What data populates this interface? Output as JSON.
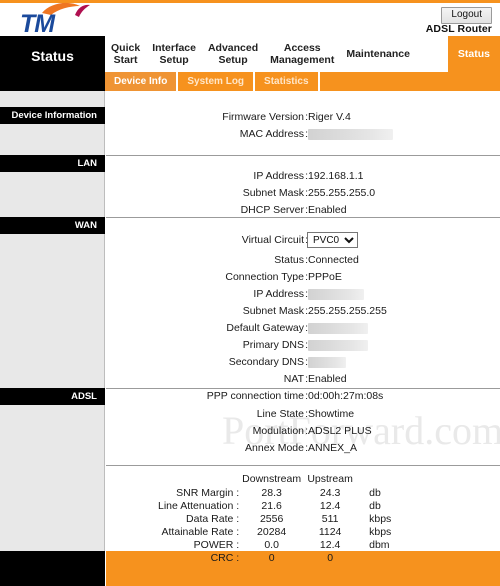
{
  "header": {
    "logo_text": "TM",
    "logout_label": "Logout",
    "router_name": "ADSL Router"
  },
  "nav": {
    "status_box_label": "Status",
    "items": [
      {
        "label": "Quick\nStart",
        "active": false
      },
      {
        "label": "Interface\nSetup",
        "active": false
      },
      {
        "label": "Advanced\nSetup",
        "active": false
      },
      {
        "label": "Access\nManagement",
        "active": false
      },
      {
        "label": "Maintenance",
        "active": false
      },
      {
        "label": "Status",
        "active": true
      }
    ],
    "subnav": [
      {
        "label": "Device Info",
        "active": true
      },
      {
        "label": "System Log",
        "active": false
      },
      {
        "label": "Statistics",
        "active": false
      }
    ]
  },
  "sidebar": {
    "sections": [
      {
        "label": "Device Information"
      },
      {
        "label": "LAN"
      },
      {
        "label": "WAN"
      },
      {
        "label": "ADSL"
      }
    ]
  },
  "device_information": {
    "firmware_version": {
      "label": "Firmware Version",
      "value": "Riger V.4"
    },
    "mac_address": {
      "label": "MAC Address",
      "value": "",
      "redacted": true
    }
  },
  "lan": {
    "ip_address": {
      "label": "IP Address",
      "value": "192.168.1.1"
    },
    "subnet_mask": {
      "label": "Subnet Mask",
      "value": "255.255.255.0"
    },
    "dhcp_server": {
      "label": "DHCP Server",
      "value": "Enabled"
    }
  },
  "wan": {
    "virtual_circuit": {
      "label": "Virtual Circuit",
      "value": "PVC0",
      "options": [
        "PVC0"
      ]
    },
    "status": {
      "label": "Status",
      "value": "Connected"
    },
    "connection_type": {
      "label": "Connection Type",
      "value": "PPPoE"
    },
    "ip_address": {
      "label": "IP Address",
      "value": "",
      "redacted": true
    },
    "subnet_mask": {
      "label": "Subnet Mask",
      "value": "255.255.255.255"
    },
    "default_gateway": {
      "label": "Default Gateway",
      "value": "",
      "redacted": true
    },
    "primary_dns": {
      "label": "Primary DNS",
      "value": "",
      "redacted": true
    },
    "secondary_dns": {
      "label": "Secondary DNS",
      "value": "",
      "redacted": true
    },
    "nat": {
      "label": "NAT",
      "value": "Enabled"
    },
    "ppp_connection_time": {
      "label": "PPP connection time",
      "value": "0d:00h:27m:08s"
    }
  },
  "adsl": {
    "line_state": {
      "label": "Line State",
      "value": "Showtime"
    },
    "modulation": {
      "label": "Modulation",
      "value": "ADSL2 PLUS"
    },
    "annex_mode": {
      "label": "Annex Mode",
      "value": "ANNEX_A"
    }
  },
  "adsl_stats": {
    "columns": [
      "Downstream",
      "Upstream"
    ],
    "rows": [
      {
        "name": "SNR Margin",
        "downstream": "28.3",
        "upstream": "24.3",
        "unit": "db"
      },
      {
        "name": "Line Attenuation",
        "downstream": "21.6",
        "upstream": "12.4",
        "unit": "db"
      },
      {
        "name": "Data Rate",
        "downstream": "2556",
        "upstream": "511",
        "unit": "kbps"
      },
      {
        "name": "Attainable Rate",
        "downstream": "20284",
        "upstream": "1124",
        "unit": "kbps"
      },
      {
        "name": "POWER",
        "downstream": "0.0",
        "upstream": "12.4",
        "unit": "dbm"
      },
      {
        "name": "CRC",
        "downstream": "0",
        "upstream": "0",
        "unit": ""
      }
    ]
  },
  "watermark": {
    "text": "PortForward.com"
  },
  "colors": {
    "brand_orange": "#f6921e",
    "logo_blue": "#1b4a9c",
    "logo_red": "#b01050",
    "sidebar_gray": "#e8e8e8",
    "black": "#000000"
  }
}
